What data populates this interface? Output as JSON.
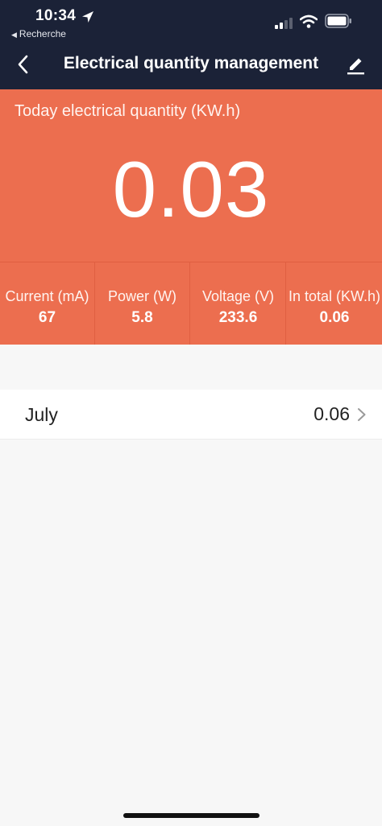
{
  "status_bar": {
    "time": "10:34",
    "back_app": "Recherche"
  },
  "nav": {
    "title": "Electrical quantity management"
  },
  "hero": {
    "label": "Today electrical quantity (KW.h)",
    "value": "0.03",
    "background": "#ec6e4f"
  },
  "stats": [
    {
      "label": "Current (mA)",
      "value": "67"
    },
    {
      "label": "Power (W)",
      "value": "5.8"
    },
    {
      "label": "Voltage (V)",
      "value": "233.6"
    },
    {
      "label": "In total (KW.h)",
      "value": "0.06"
    }
  ],
  "months": [
    {
      "name": "July",
      "value": "0.06"
    }
  ],
  "icons": {
    "back": "chevron-left-icon",
    "edit": "pencil-icon",
    "row": "chevron-right-icon"
  }
}
